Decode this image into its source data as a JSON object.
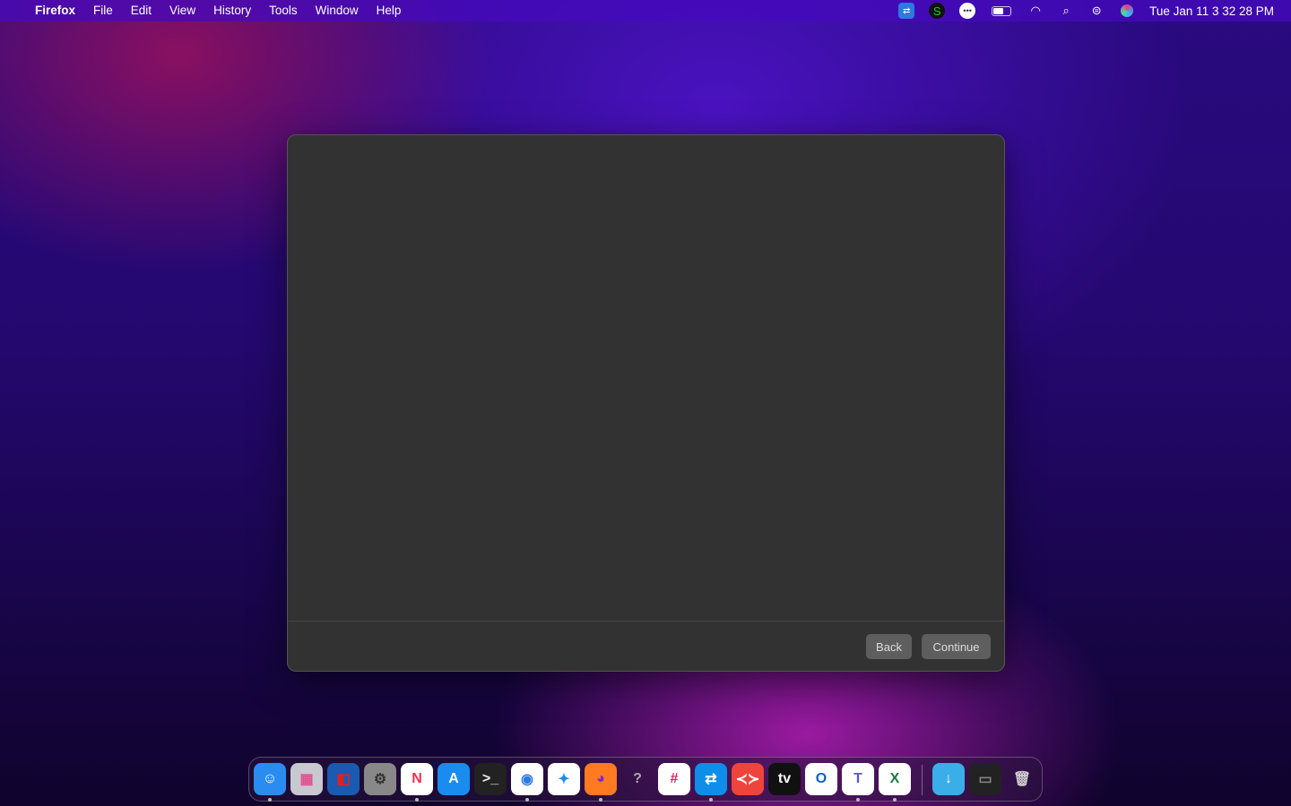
{
  "menubar": {
    "app": "Firefox",
    "items": [
      "File",
      "Edit",
      "View",
      "History",
      "Tools",
      "Window",
      "Help"
    ],
    "status_icons": [
      "teamviewer-icon",
      "s-app-icon",
      "messenger-icon",
      "battery-icon",
      "wifi-icon",
      "search-icon",
      "control-center-icon",
      "siri-icon"
    ],
    "clock": "Tue Jan 11  3 32 28 PM"
  },
  "dialog": {
    "back_label": "Back",
    "continue_label": "Continue"
  },
  "dock": {
    "apps": [
      {
        "name": "finder",
        "label": "☺",
        "bg": "#2a8cf0",
        "fg": "#fff",
        "running": true
      },
      {
        "name": "launchpad",
        "label": "▦",
        "bg": "#c8c8d0",
        "fg": "#e05090",
        "running": false
      },
      {
        "name": "vmware",
        "label": "◧",
        "bg": "#1a5ab0",
        "fg": "#e02020",
        "running": false
      },
      {
        "name": "system-preferences",
        "label": "⚙",
        "bg": "#888",
        "fg": "#333",
        "running": false
      },
      {
        "name": "news",
        "label": "N",
        "bg": "#fff",
        "fg": "#f03050",
        "running": true
      },
      {
        "name": "app-store",
        "label": "A",
        "bg": "#1a8cf0",
        "fg": "#fff",
        "running": false
      },
      {
        "name": "terminal",
        "label": ">_",
        "bg": "#222",
        "fg": "#eee",
        "running": false
      },
      {
        "name": "chrome",
        "label": "◉",
        "bg": "#fff",
        "fg": "#2a7ae0",
        "running": true
      },
      {
        "name": "safari",
        "label": "✦",
        "bg": "#fff",
        "fg": "#1a8cf0",
        "running": false
      },
      {
        "name": "firefox",
        "label": "◕",
        "bg": "#ff7a20",
        "fg": "#7a2ad0",
        "running": true
      },
      {
        "name": "help",
        "label": "?",
        "bg": "transparent",
        "fg": "#aaa",
        "running": false
      },
      {
        "name": "slack",
        "label": "#",
        "bg": "#fff",
        "fg": "#e01e5a",
        "running": false
      },
      {
        "name": "teamviewer",
        "label": "⇄",
        "bg": "#0e8ee9",
        "fg": "#fff",
        "running": true
      },
      {
        "name": "anydesk",
        "label": "≺≻",
        "bg": "#ef443b",
        "fg": "#fff",
        "running": false
      },
      {
        "name": "apple-tv",
        "label": "tv",
        "bg": "#111",
        "fg": "#fff",
        "running": false
      },
      {
        "name": "outlook",
        "label": "O",
        "bg": "#fff",
        "fg": "#0a64c8",
        "running": false
      },
      {
        "name": "teams",
        "label": "T",
        "bg": "#fff",
        "fg": "#5a5ac0",
        "running": true
      },
      {
        "name": "excel",
        "label": "X",
        "bg": "#fff",
        "fg": "#1d7a40",
        "running": true
      },
      {
        "name": "downloads-folder",
        "label": "↓",
        "bg": "#3aaee8",
        "fg": "#fff",
        "running": false
      },
      {
        "name": "firefox-window",
        "label": "▭",
        "bg": "#222",
        "fg": "#888",
        "running": false
      },
      {
        "name": "trash",
        "label": "🗑",
        "bg": "transparent",
        "fg": "#ccc",
        "running": false
      }
    ]
  }
}
